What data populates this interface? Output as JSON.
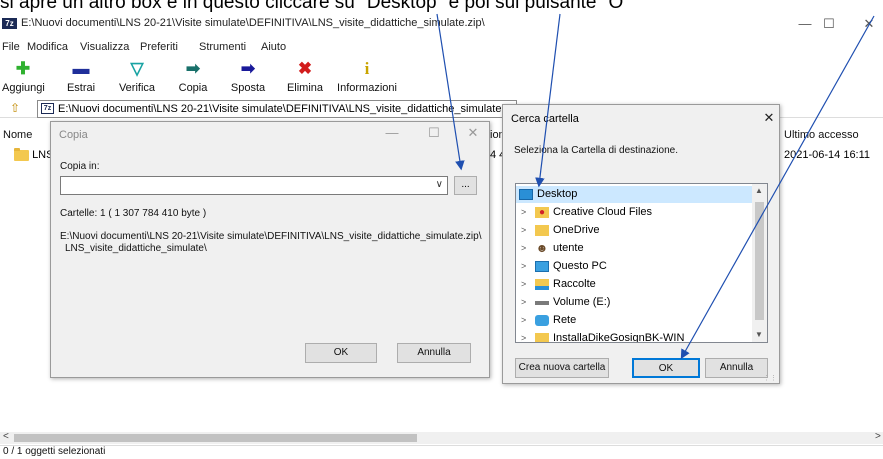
{
  "caption": "si apre un altro box e in questo cliccare su \"Desktop\" e poi sul pulsante \"O",
  "window": {
    "app_icon": "7z",
    "title": "E:\\Nuovi documenti\\LNS 20-21\\Visite simulate\\DEFINITIVA\\LNS_visite_didattiche_simulate.zip\\",
    "minimize": "—",
    "maximize": "☐",
    "close": "✕"
  },
  "menu": [
    "File",
    "Modifica",
    "Visualizza",
    "Preferiti",
    "Strumenti",
    "Aiuto"
  ],
  "toolbar": [
    {
      "label": "Aggiungi",
      "icon": "plus-icon",
      "glyph": "✚",
      "color": "#2fb12f"
    },
    {
      "label": "Estrai",
      "icon": "minus-icon",
      "glyph": "▬",
      "color": "#1f2f9a"
    },
    {
      "label": "Verifica",
      "icon": "check-icon",
      "glyph": "▽",
      "color": "#19a3a3"
    },
    {
      "label": "Copia",
      "icon": "copy-icon",
      "glyph": "➡",
      "color": "#18706a"
    },
    {
      "label": "Sposta",
      "icon": "move-icon",
      "glyph": "➡",
      "color": "#1a1a9a"
    },
    {
      "label": "Elimina",
      "icon": "delete-icon",
      "glyph": "✖",
      "color": "#d21c1c"
    },
    {
      "label": "Informazioni",
      "icon": "info-icon",
      "glyph": "i",
      "color": "#c9a400"
    }
  ],
  "address": {
    "path": "E:\\Nuovi documenti\\LNS 20-21\\Visite simulate\\DEFINITIVA\\LNS_visite_didattiche_simulate.zip\\"
  },
  "columns": {
    "name": "Nome",
    "partial": "ion",
    "last_access": "Ultimo accesso"
  },
  "file_row": {
    "name": "LNS",
    "partial_value": "4 4",
    "last_access": "2021-06-14 16:11"
  },
  "status": "0 / 1 oggetti selezionati",
  "copy_dialog": {
    "title": "Copia",
    "copy_to_label": "Copia in:",
    "destination_value": "",
    "dots_button": "...",
    "folders_info": "Cartelle: 1    ( 1 307 784 410 byte )",
    "path_line1": "E:\\Nuovi documenti\\LNS 20-21\\Visite simulate\\DEFINITIVA\\LNS_visite_didattiche_simulate.zip\\",
    "path_line2": "LNS_visite_didattiche_simulate\\",
    "ok": "OK",
    "cancel": "Annulla"
  },
  "folder_dialog": {
    "title": "Cerca cartella",
    "close": "✕",
    "instruction": "Seleziona la Cartella di destinazione.",
    "items": [
      {
        "label": "Desktop",
        "icon": "desktop-icon",
        "selected": true,
        "expandable": false
      },
      {
        "label": "Creative Cloud Files",
        "icon": "creative-cloud-folder-icon",
        "selected": false,
        "expandable": true
      },
      {
        "label": "OneDrive",
        "icon": "folder-icon",
        "selected": false,
        "expandable": true
      },
      {
        "label": "utente",
        "icon": "user-icon",
        "selected": false,
        "expandable": true
      },
      {
        "label": "Questo PC",
        "icon": "computer-icon",
        "selected": false,
        "expandable": true
      },
      {
        "label": "Raccolte",
        "icon": "libraries-icon",
        "selected": false,
        "expandable": true
      },
      {
        "label": "Volume (E:)",
        "icon": "drive-icon",
        "selected": false,
        "expandable": true
      },
      {
        "label": "Rete",
        "icon": "network-icon",
        "selected": false,
        "expandable": true
      },
      {
        "label": "InstallaDikeGosignBK-WIN",
        "icon": "folder-icon",
        "selected": false,
        "expandable": true
      }
    ],
    "new_folder": "Crea nuova cartella",
    "ok": "OK",
    "cancel": "Annulla"
  },
  "colors": {
    "annotation_arrow": "#1f4fb0",
    "selection": "#cce8ff",
    "ok_focus": "#0078d7"
  }
}
